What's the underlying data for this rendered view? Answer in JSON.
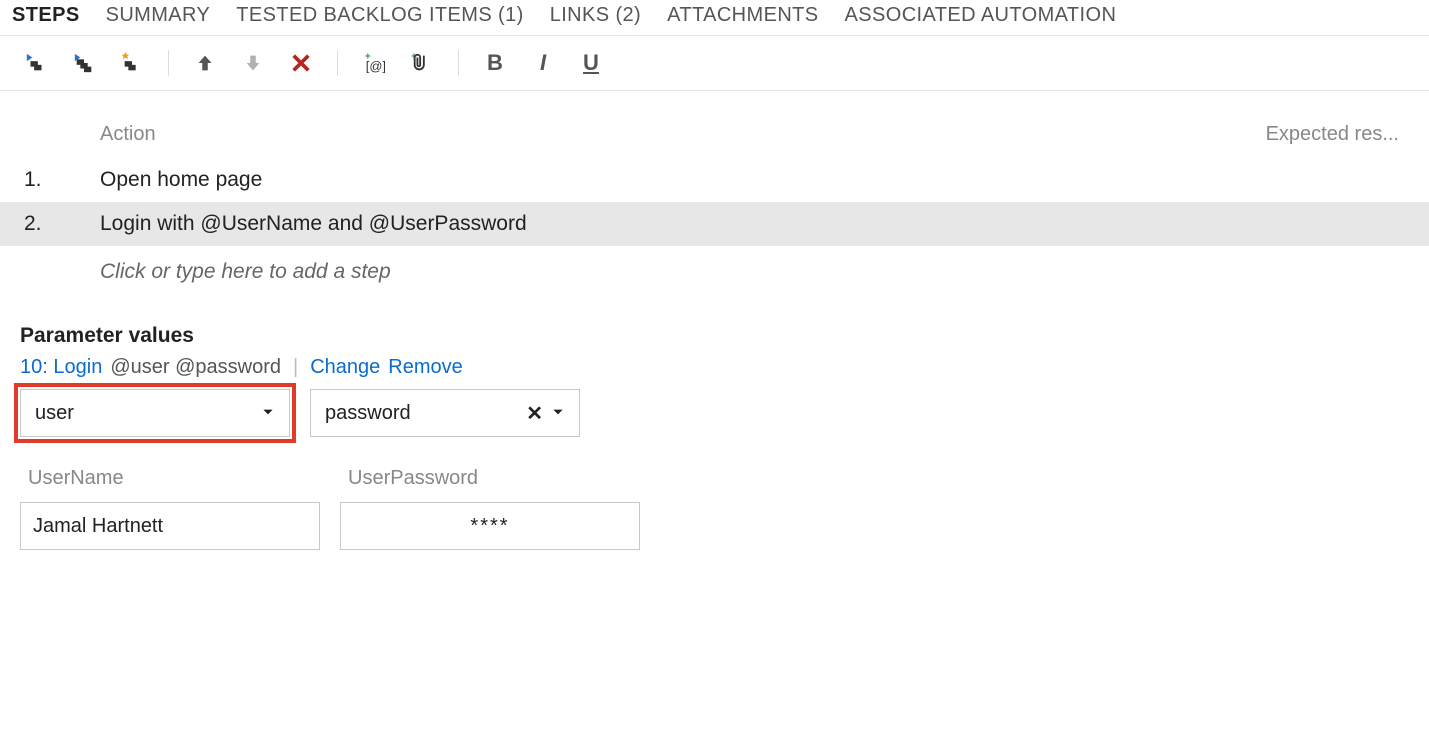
{
  "tabs": [
    {
      "label": "STEPS",
      "active": true
    },
    {
      "label": "SUMMARY",
      "active": false
    },
    {
      "label": "TESTED BACKLOG ITEMS (1)",
      "active": false
    },
    {
      "label": "LINKS (2)",
      "active": false
    },
    {
      "label": "ATTACHMENTS",
      "active": false
    },
    {
      "label": "ASSOCIATED AUTOMATION",
      "active": false
    }
  ],
  "columns": {
    "action": "Action",
    "expected": "Expected res..."
  },
  "steps": [
    {
      "num": "1.",
      "action": "Open home page",
      "selected": false
    },
    {
      "num": "2.",
      "action": "Login with  @UserName and  @UserPassword",
      "selected": true
    }
  ],
  "addStepPlaceholder": "Click or type here to add a step",
  "params": {
    "heading": "Parameter values",
    "sharedSet": {
      "id": "10",
      "name": "Login",
      "suffix": "@user @password"
    },
    "actions": {
      "change": "Change",
      "remove": "Remove"
    },
    "selects": [
      {
        "value": "user",
        "clearable": false,
        "highlight": true
      },
      {
        "value": "password",
        "clearable": true,
        "highlight": false
      }
    ],
    "table": {
      "headers": [
        "UserName",
        "UserPassword"
      ],
      "row": {
        "user": "Jamal Hartnett",
        "pass": "****"
      }
    }
  }
}
